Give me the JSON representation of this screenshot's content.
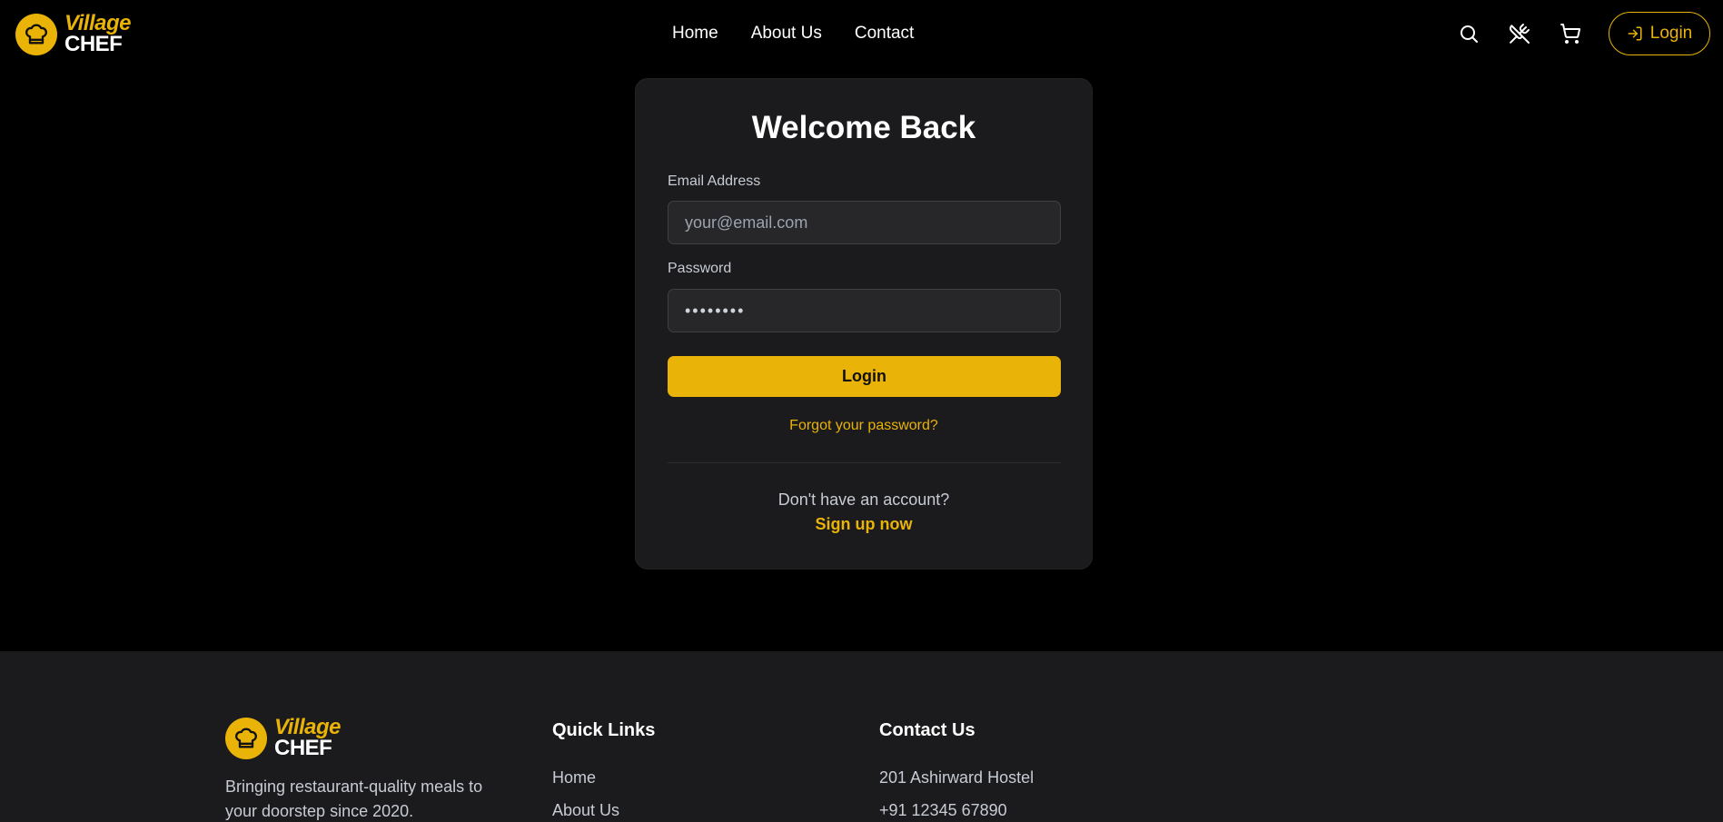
{
  "brand": {
    "name_top": "Village",
    "name_bottom": "CHEF",
    "accent_color": "#eab308"
  },
  "nav": {
    "items": [
      "Home",
      "About Us",
      "Contact"
    ]
  },
  "header_actions": {
    "icons": [
      "search-icon",
      "utensils-icon",
      "cart-icon"
    ],
    "login_label": "Login"
  },
  "login_card": {
    "title": "Welcome Back",
    "email_label": "Email Address",
    "email_placeholder": "your@email.com",
    "password_label": "Password",
    "password_value": "••••••••",
    "submit_label": "Login",
    "forgot_label": "Forgot your password?",
    "no_account_text": "Don't have an account?",
    "signup_label": "Sign up now"
  },
  "footer": {
    "tagline": "Bringing restaurant-quality meals to your doorstep since 2020.",
    "quick_links_title": "Quick Links",
    "quick_links": [
      "Home",
      "About Us"
    ],
    "contact_title": "Contact Us",
    "contact_lines": [
      "201 Ashirward Hostel",
      "+91 12345 67890"
    ]
  }
}
